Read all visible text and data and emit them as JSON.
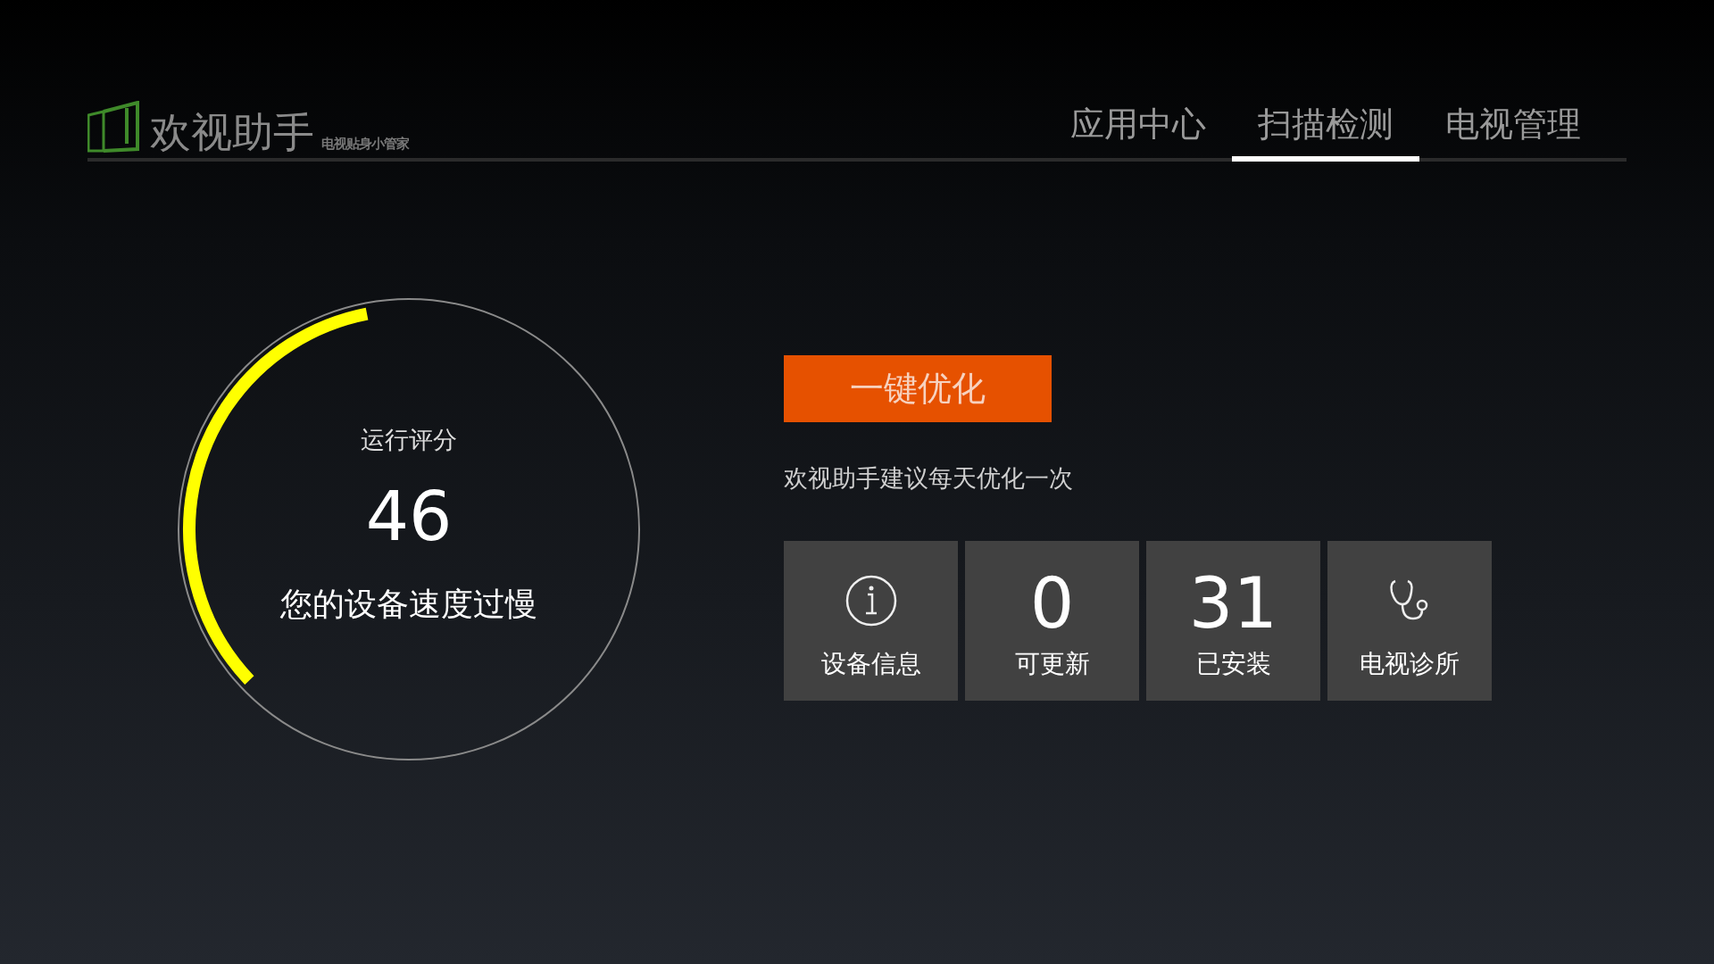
{
  "app": {
    "title": "欢视助手",
    "subtitle": "电视贴身小管家"
  },
  "tabs": [
    {
      "label": "应用中心",
      "selected": false
    },
    {
      "label": "扫描检测",
      "selected": true
    },
    {
      "label": "电视管理",
      "selected": false
    }
  ],
  "gauge": {
    "label": "运行评分",
    "score": "46",
    "level": 0.34,
    "status": "您的设备速度过慢"
  },
  "optimize_button": "一键优化",
  "hint": "欢视助手建议每天优化一次",
  "tiles": [
    {
      "kind": "info",
      "label": "设备信息"
    },
    {
      "kind": "count",
      "value": "0",
      "label": "可更新"
    },
    {
      "kind": "count",
      "value": "31",
      "label": "已安装"
    },
    {
      "kind": "stethoscope",
      "label": "电视诊所"
    }
  ]
}
